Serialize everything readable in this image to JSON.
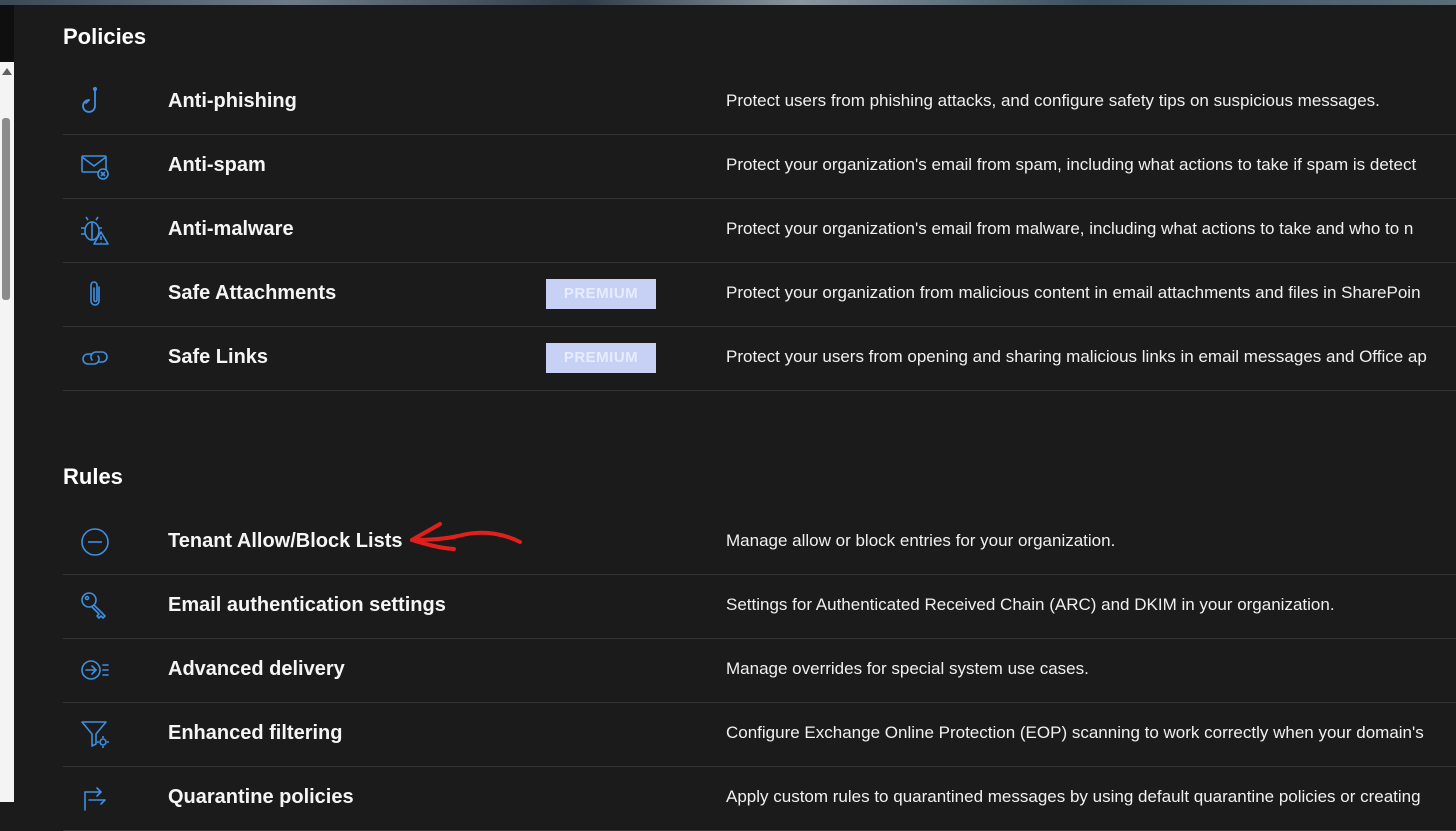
{
  "policies": {
    "title": "Policies",
    "items": [
      {
        "name": "Anti-phishing",
        "icon": "hook-icon",
        "badge": "",
        "description": "Protect users from phishing attacks, and configure safety tips on suspicious messages."
      },
      {
        "name": "Anti-spam",
        "icon": "mail-blocked-icon",
        "badge": "",
        "description": "Protect your organization's email from spam, including what actions to take if spam is detect"
      },
      {
        "name": "Anti-malware",
        "icon": "bug-warning-icon",
        "badge": "",
        "description": "Protect your organization's email from malware, including what actions to take and who to n"
      },
      {
        "name": "Safe Attachments",
        "icon": "paperclip-icon",
        "badge": "PREMIUM",
        "description": "Protect your organization from malicious content in email attachments and files in SharePoin"
      },
      {
        "name": "Safe Links",
        "icon": "link-icon",
        "badge": "PREMIUM",
        "description": "Protect your users from opening and sharing malicious links in email messages and Office ap"
      }
    ]
  },
  "rules": {
    "title": "Rules",
    "items": [
      {
        "name": "Tenant Allow/Block Lists",
        "icon": "block-circle-icon",
        "badge": "",
        "description": "Manage allow or block entries for your organization."
      },
      {
        "name": "Email authentication settings",
        "icon": "key-icon",
        "badge": "",
        "description": "Settings for Authenticated Received Chain (ARC) and DKIM in your organization."
      },
      {
        "name": "Advanced delivery",
        "icon": "delivery-icon",
        "badge": "",
        "description": "Manage overrides for special system use cases."
      },
      {
        "name": "Enhanced filtering",
        "icon": "filter-settings-icon",
        "badge": "",
        "description": "Configure Exchange Online Protection (EOP) scanning to work correctly when your domain's"
      },
      {
        "name": "Quarantine policies",
        "icon": "quarantine-icon",
        "badge": "",
        "description": "Apply custom rules to quarantined messages by using default quarantine policies or creating"
      }
    ]
  },
  "colors": {
    "accent": "#3f8fe0",
    "background": "#1b1b1b",
    "badge": "#c7d0f5",
    "annotation": "#e0201c"
  }
}
